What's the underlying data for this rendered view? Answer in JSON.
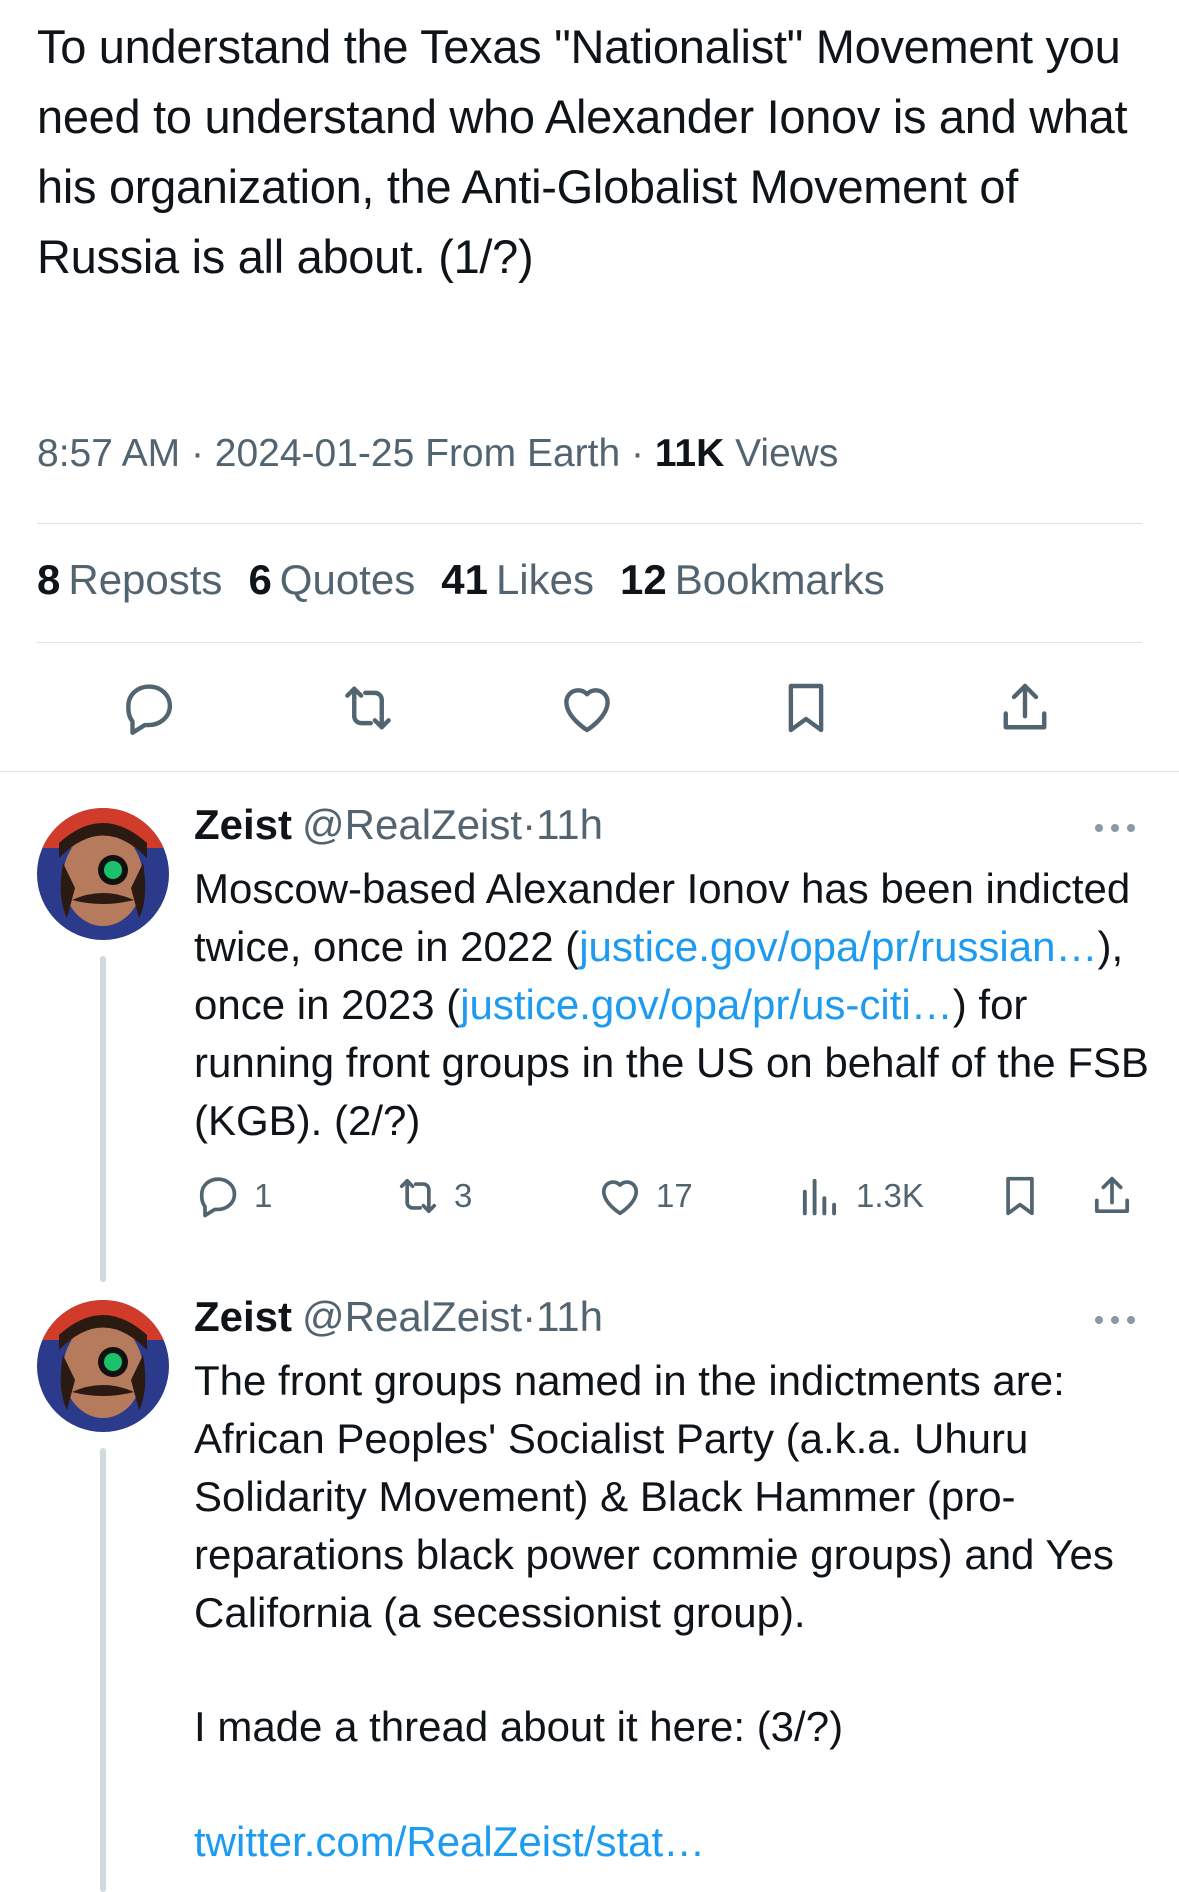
{
  "main_tweet": {
    "text": "To understand the Texas \"Nationalist\" Movement you need to understand who Alexander Ionov is and what his organization, the Anti-Globalist Movement of Russia is all about. (1/?)",
    "time": "8:57 AM",
    "date": "2024-01-25",
    "source": "From Earth",
    "views_count": "11K",
    "views_label": "Views",
    "separator": "·"
  },
  "stats": {
    "reposts_count": "8",
    "reposts_label": "Reposts",
    "quotes_count": "6",
    "quotes_label": "Quotes",
    "likes_count": "41",
    "likes_label": "Likes",
    "bookmarks_count": "12",
    "bookmarks_label": "Bookmarks"
  },
  "actions": {
    "icons": [
      "reply-icon",
      "repost-icon",
      "like-icon",
      "bookmark-icon",
      "share-icon"
    ]
  },
  "replies": [
    {
      "name": "Zeist",
      "handle": "@RealZeist",
      "time": "11h",
      "text_1": "Moscow-based Alexander Ionov has been indicted twice, once in 2022 (",
      "link_1": "justice.gov/opa/pr/russian…",
      "text_2": "), once in 2023 (",
      "link_2": "justice.gov/opa/pr/us-citi…",
      "text_3": ") for running front groups in the US on behalf of the FSB (KGB). (2/?)",
      "reply_count": "1",
      "repost_count": "3",
      "like_count": "17",
      "view_count": "1.3K"
    },
    {
      "name": "Zeist",
      "handle": "@RealZeist",
      "time": "11h",
      "text_1": "The front groups named in the indictments are: African Peoples' Socialist Party (a.k.a. Uhuru Solidarity Movement) & Black Hammer (pro-reparations black power commie groups) and Yes California (a secessionist group).",
      "text_2": "I made a thread about it here: (3/?)",
      "link_1": "twitter.com/RealZeist/stat…"
    }
  ],
  "colors": {
    "link": "#1d9bf0",
    "secondary": "#536471",
    "primary": "#0f1419",
    "divider": "#dfe3e7"
  }
}
